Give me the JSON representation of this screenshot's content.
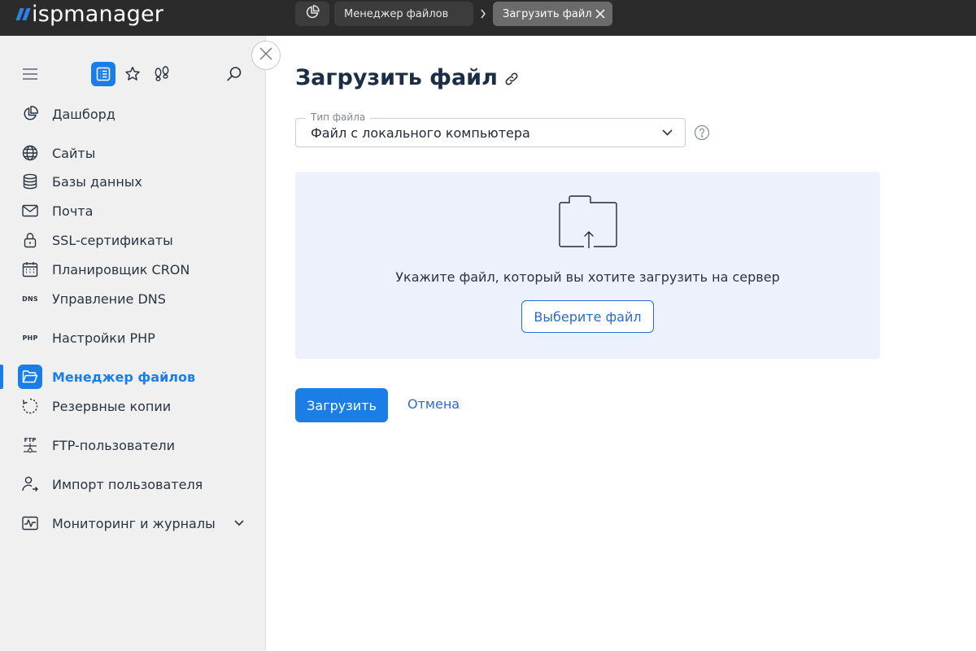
{
  "app": {
    "brand": "ispmanager"
  },
  "topbar": {
    "home_icon": "dashboard-pie-icon",
    "tabs": [
      {
        "label": "Менеджер файлов"
      },
      {
        "label": "Загрузить файл"
      }
    ],
    "separator_icon": "chevron-right-icon",
    "close_icon": "close-icon"
  },
  "sidebar": {
    "tools": [
      "menu-icon",
      "list-icon",
      "star-icon",
      "footprints-icon",
      "search-icon"
    ],
    "items": [
      {
        "label": "Дашборд",
        "icon": "dashboard-icon"
      },
      {
        "label": "Сайты",
        "icon": "globe-icon"
      },
      {
        "label": "Базы данных",
        "icon": "database-icon"
      },
      {
        "label": "Почта",
        "icon": "mail-icon"
      },
      {
        "label": "SSL-сертификаты",
        "icon": "lock-icon"
      },
      {
        "label": "Планировщик CRON",
        "icon": "calendar-icon"
      },
      {
        "label": "Управление DNS",
        "icon": "dns-icon",
        "icon_text": "DNS"
      },
      {
        "label": "Настройки PHP",
        "icon": "php-icon",
        "icon_text": "PHP"
      },
      {
        "label": "Менеджер файлов",
        "icon": "folder-open-icon",
        "active": true
      },
      {
        "label": "Резервные копии",
        "icon": "backup-icon"
      },
      {
        "label": "FTP-пользователи",
        "icon": "ftp-icon",
        "icon_text": "FTP"
      },
      {
        "label": "Импорт пользователя",
        "icon": "user-import-icon"
      },
      {
        "label": "Мониторинг и журналы",
        "icon": "monitoring-icon"
      }
    ]
  },
  "main": {
    "title": "Загрузить файл",
    "file_type": {
      "legend": "Тип файла",
      "value": "Файл с локального компьютера"
    },
    "dropzone": {
      "text": "Укажите файл, который вы хотите загрузить на сервер",
      "choose_label": "Выберите файл"
    },
    "actions": {
      "upload_label": "Загрузить",
      "cancel_label": "Отмена"
    }
  },
  "colors": {
    "accent": "#1a7ee6",
    "topbar_bg": "#2b2b2b",
    "sidebar_bg": "#f0f0f0",
    "dropzone_bg": "#edf1fb"
  }
}
